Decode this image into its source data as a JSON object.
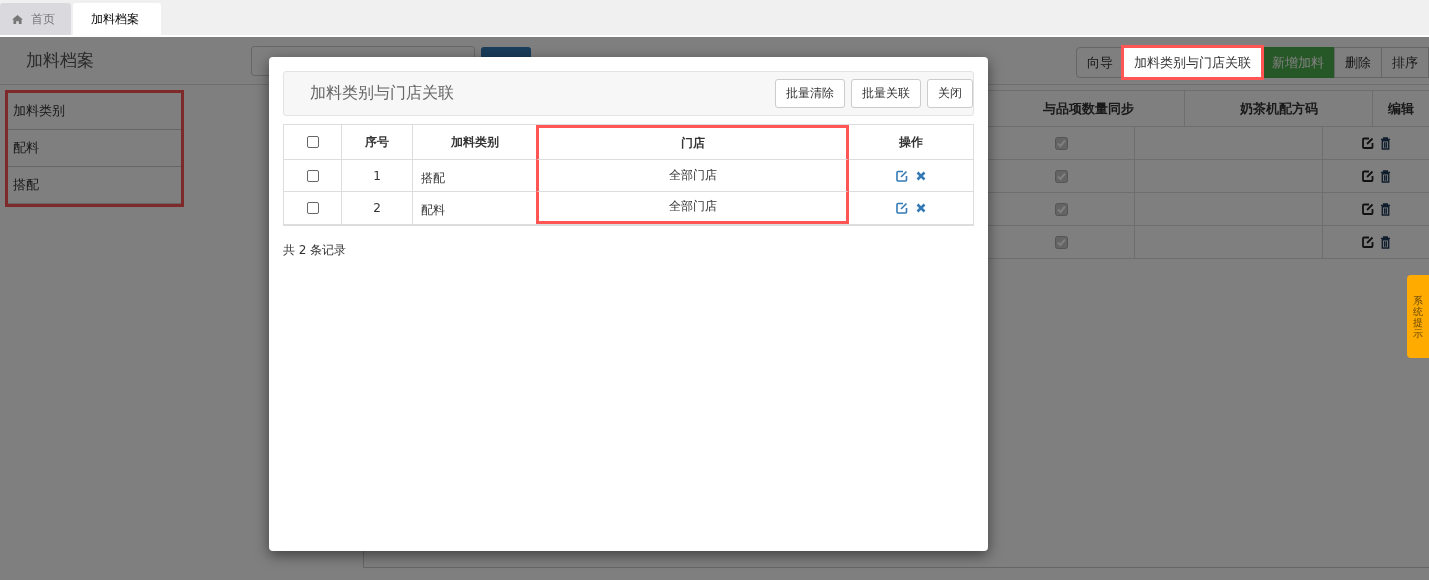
{
  "tabs": [
    {
      "label": "首页",
      "selected": false
    },
    {
      "label": "加料档案",
      "selected": true
    }
  ],
  "page": {
    "title": "加料档案",
    "toolbar": [
      {
        "label": "向导",
        "kind": "default",
        "highlighted": false
      },
      {
        "label": "加料类别与门店关联",
        "kind": "default",
        "highlighted": true
      },
      {
        "label": "新增加料",
        "kind": "primary",
        "highlighted": false
      },
      {
        "label": "删除",
        "kind": "default",
        "highlighted": false
      },
      {
        "label": "排序",
        "kind": "default",
        "highlighted": false
      }
    ]
  },
  "category_list": {
    "highlighted": true,
    "heading": "加料类别",
    "items": [
      "配料",
      "搭配"
    ]
  },
  "table": {
    "columns": [
      "与品项数量同步",
      "奶茶机配方码",
      "编辑"
    ],
    "rows": [
      {
        "synced": true
      },
      {
        "synced": true
      },
      {
        "synced": true
      },
      {
        "synced": true
      }
    ]
  },
  "dialog": {
    "title": "加料类别与门店关联",
    "buttons": [
      "批量清除",
      "批量关联",
      "关闭"
    ],
    "all_checked": false,
    "columns": [
      {
        "label": "序号",
        "highlighted": false
      },
      {
        "label": "加料类别",
        "highlighted": false
      },
      {
        "label": "门店",
        "highlighted": true
      },
      {
        "label": "操作",
        "highlighted": false
      }
    ],
    "rows": [
      {
        "checked": false,
        "index": "1",
        "category": "搭配",
        "store": "全部门店"
      },
      {
        "checked": false,
        "index": "2",
        "category": "配料",
        "store": "全部门店"
      }
    ],
    "footer": "共 2 条记录"
  },
  "side_tab": {
    "label": "系统提示"
  }
}
